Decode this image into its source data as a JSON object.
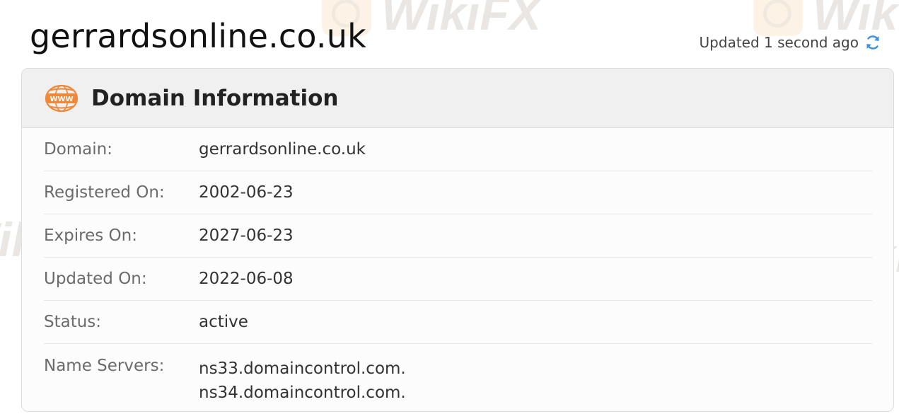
{
  "header": {
    "title": "gerrardsonline.co.uk",
    "updated_text": "Updated 1 second ago"
  },
  "card": {
    "title": "Domain Information",
    "icon": "www-globe-icon",
    "rows": [
      {
        "label": "Domain:",
        "value": "gerrardsonline.co.uk"
      },
      {
        "label": "Registered On:",
        "value": "2002-06-23"
      },
      {
        "label": "Expires On:",
        "value": "2027-06-23"
      },
      {
        "label": "Updated On:",
        "value": "2022-06-08"
      },
      {
        "label": "Status:",
        "value": "active"
      }
    ],
    "name_servers": {
      "label": "Name Servers:",
      "values": [
        "ns33.domaincontrol.com.",
        "ns34.domaincontrol.com."
      ]
    }
  },
  "watermark": {
    "text": "WikiFX"
  },
  "colors": {
    "accent_orange": "#f0883a",
    "refresh_blue": "#3b8fe0"
  }
}
